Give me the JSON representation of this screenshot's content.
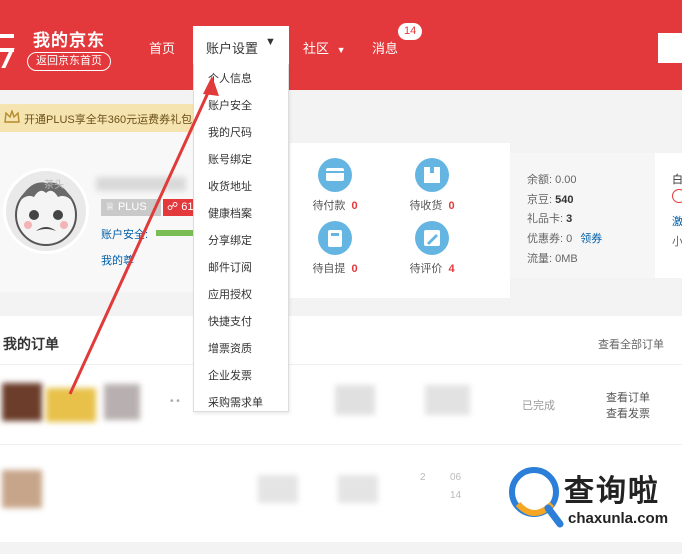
{
  "header": {
    "brand_title": "我的京东",
    "brand_back": "返回京东首页",
    "nav_home": "首页",
    "nav_account": "账户设置",
    "nav_community": "社区",
    "nav_messages": "消息",
    "message_count": "14"
  },
  "dropdown": {
    "items": [
      "个人信息",
      "账户安全",
      "我的尺码",
      "账号绑定",
      "收货地址",
      "健康档案",
      "分享绑定",
      "邮件订阅",
      "应用授权",
      "快捷支付",
      "增票资质",
      "企业发票",
      "采购需求单"
    ]
  },
  "plus": {
    "banner": "开通PLUS享全年360元运费券礼包",
    "tag": "PLUS",
    "num": "61",
    "avatar_text": "茶头"
  },
  "profile": {
    "security": "账户安全:",
    "my_vip": "我的尊"
  },
  "order_stats": [
    {
      "label": "待付款",
      "count": "0"
    },
    {
      "label": "待收货",
      "count": "0"
    },
    {
      "label": "待自提",
      "count": "0"
    },
    {
      "label": "待评价",
      "count": "4"
    }
  ],
  "assets": {
    "balance_label": "余额:",
    "balance": "0.00",
    "jingdou_label": "京豆:",
    "jingdou": "540",
    "giftcard_label": "礼品卡:",
    "giftcard": "3",
    "coupon_label": "优惠券:",
    "coupon": "0",
    "coupon_link": "领券",
    "traffic_label": "流量:",
    "traffic": "0MB"
  },
  "right_clip": {
    "t1": "白",
    "t2": "激",
    "t3": "小"
  },
  "orders": {
    "title": "我的订单",
    "view_all": "查看全部订单",
    "row1_status": "已完成",
    "row1_view_order": "查看订单",
    "row1_view_invoice": "查看发票",
    "row2_date_fragment": "2",
    "row2_date_fragment2": "06",
    "row2_date_fragment3": "14"
  },
  "watermark": {
    "title": "查询啦",
    "url": "chaxunla.com"
  },
  "colors": {
    "brand_red": "#e4393c",
    "link_blue": "#005ea7",
    "icon_blue": "#65b5e2"
  }
}
